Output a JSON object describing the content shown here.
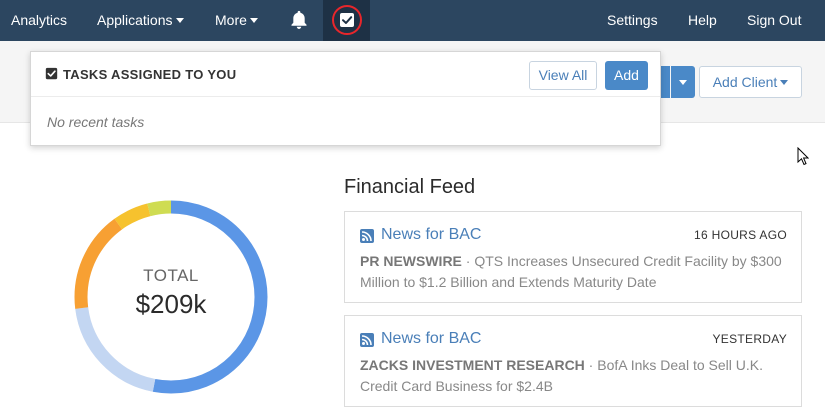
{
  "nav": {
    "analytics": "Analytics",
    "applications": "Applications",
    "more": "More",
    "settings": "Settings",
    "help": "Help",
    "sign_out": "Sign Out"
  },
  "toolbar": {
    "add_client": "Add Client"
  },
  "tasks_dropdown": {
    "title": "TASKS ASSIGNED TO YOU",
    "view_all": "View All",
    "add": "Add",
    "empty_message": "No recent tasks"
  },
  "total": {
    "label": "TOTAL",
    "value": "$209k"
  },
  "donut_segments": [
    {
      "color": "#5b96e6",
      "fraction": 0.53
    },
    {
      "color": "#c3d6f2",
      "fraction": 0.2
    },
    {
      "color": "#f7a033",
      "fraction": 0.17
    },
    {
      "color": "#f6c22e",
      "fraction": 0.06
    },
    {
      "color": "#cfdc52",
      "fraction": 0.04
    }
  ],
  "feed": {
    "title": "Financial Feed",
    "items": [
      {
        "source": "News for BAC",
        "time": "16 HOURS AGO",
        "publisher": "PR NEWSWIRE",
        "separator": " · ",
        "headline": "QTS Increases Unsecured Credit Facility by $300 Million to $1.2 Billion and Extends Maturity Date"
      },
      {
        "source": "News for BAC",
        "time": "YESTERDAY",
        "publisher": "ZACKS INVESTMENT RESEARCH",
        "separator": " · ",
        "headline": "BofA Inks Deal to Sell U.K. Credit Card Business for $2.4B"
      }
    ]
  },
  "colors": {
    "nav_bg": "#2c4660",
    "accent": "#4a89c8",
    "link": "#4a7fb8",
    "highlight_ring": "#e8262b"
  }
}
